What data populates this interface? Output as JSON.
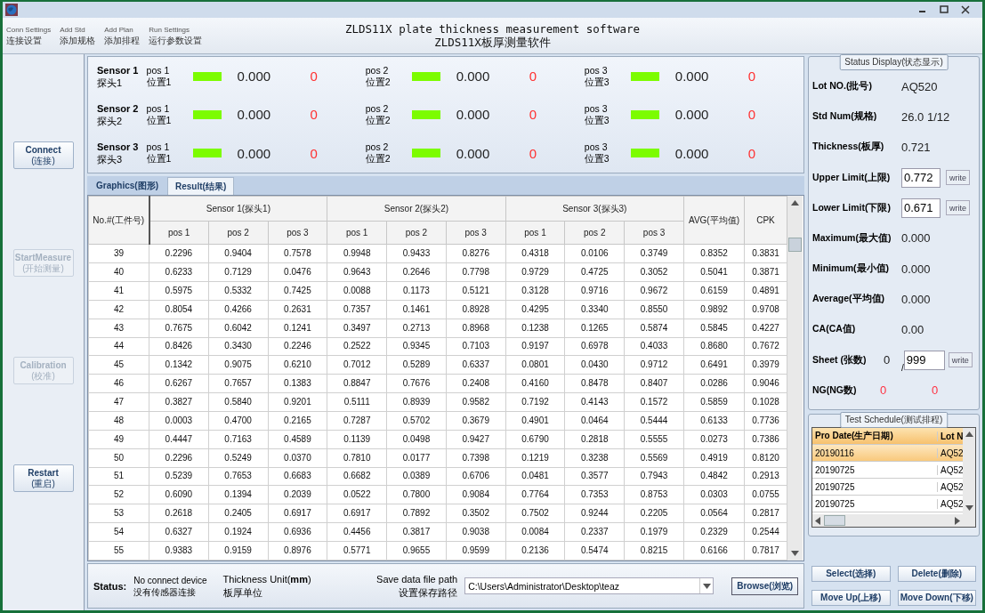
{
  "toolbar": [
    {
      "en": "Conn Settings",
      "zh": "连接设置"
    },
    {
      "en": "Add Std",
      "zh": "添加规格"
    },
    {
      "en": "Add Plan",
      "zh": "添加排程"
    },
    {
      "en": "Run Settings",
      "zh": "运行参数设置"
    }
  ],
  "title": {
    "en": "ZLDS11X plate thickness measurement software",
    "zh": "ZLDS11X板厚测量软件"
  },
  "side_buttons": [
    {
      "en": "Connect",
      "zh": "(连接)",
      "disabled": false
    },
    {
      "en": "StartMeasure",
      "zh": "(开始测量)",
      "disabled": true
    },
    {
      "en": "Calibration",
      "zh": "(校准)",
      "disabled": true
    },
    {
      "en": "Restart",
      "zh": "(重启)",
      "disabled": false
    }
  ],
  "sensors": [
    {
      "name": "Sensor 1",
      "name_zh": "探头1",
      "positions": [
        {
          "label": "pos 1",
          "label_zh": "位置1",
          "value": "0.000",
          "count": "0"
        },
        {
          "label": "pos 2",
          "label_zh": "位置2",
          "value": "0.000",
          "count": "0"
        },
        {
          "label": "pos 3",
          "label_zh": "位置3",
          "value": "0.000",
          "count": "0"
        }
      ]
    },
    {
      "name": "Sensor 2",
      "name_zh": "探头2",
      "positions": [
        {
          "label": "pos 1",
          "label_zh": "位置1",
          "value": "0.000",
          "count": "0"
        },
        {
          "label": "pos 2",
          "label_zh": "位置2",
          "value": "0.000",
          "count": "0"
        },
        {
          "label": "pos 3",
          "label_zh": "位置3",
          "value": "0.000",
          "count": "0"
        }
      ]
    },
    {
      "name": "Sensor 3",
      "name_zh": "探头3",
      "positions": [
        {
          "label": "pos 1",
          "label_zh": "位置1",
          "value": "0.000",
          "count": "0"
        },
        {
          "label": "pos 2",
          "label_zh": "位置2",
          "value": "0.000",
          "count": "0"
        },
        {
          "label": "pos 3",
          "label_zh": "位置3",
          "value": "0.000",
          "count": "0"
        }
      ]
    }
  ],
  "tabs": [
    {
      "label": "Graphics(图形)",
      "selected": false
    },
    {
      "label": "Result(结果)",
      "selected": true
    }
  ],
  "result_table": {
    "no_header": "No.#(工件号)",
    "group_headers": [
      "Sensor 1(探头1)",
      "Sensor 2(探头2)",
      "Sensor 3(探头3)"
    ],
    "sub_headers": [
      "pos 1",
      "pos 2",
      "pos 3",
      "pos 1",
      "pos 2",
      "pos 3",
      "pos 1",
      "pos 2",
      "pos 3"
    ],
    "avg_header": "AVG(平均值)",
    "cpk_header": "CPK",
    "rows": [
      [
        "39",
        "0.2296",
        "0.9404",
        "0.7578",
        "0.9948",
        "0.9433",
        "0.8276",
        "0.4318",
        "0.0106",
        "0.3749",
        "0.8352",
        "0.3831"
      ],
      [
        "40",
        "0.6233",
        "0.7129",
        "0.0476",
        "0.9643",
        "0.2646",
        "0.7798",
        "0.9729",
        "0.4725",
        "0.3052",
        "0.5041",
        "0.3871"
      ],
      [
        "41",
        "0.5975",
        "0.5332",
        "0.7425",
        "0.0088",
        "0.1173",
        "0.5121",
        "0.3128",
        "0.9716",
        "0.9672",
        "0.6159",
        "0.4891"
      ],
      [
        "42",
        "0.8054",
        "0.4266",
        "0.2631",
        "0.7357",
        "0.1461",
        "0.8928",
        "0.4295",
        "0.3340",
        "0.8550",
        "0.9892",
        "0.9708"
      ],
      [
        "43",
        "0.7675",
        "0.6042",
        "0.1241",
        "0.3497",
        "0.2713",
        "0.8968",
        "0.1238",
        "0.1265",
        "0.5874",
        "0.5845",
        "0.4227"
      ],
      [
        "44",
        "0.8426",
        "0.3430",
        "0.2246",
        "0.2522",
        "0.9345",
        "0.7103",
        "0.9197",
        "0.6978",
        "0.4033",
        "0.8680",
        "0.7672"
      ],
      [
        "45",
        "0.1342",
        "0.9075",
        "0.6210",
        "0.7012",
        "0.5289",
        "0.6337",
        "0.0801",
        "0.0430",
        "0.9712",
        "0.6491",
        "0.3979"
      ],
      [
        "46",
        "0.6267",
        "0.7657",
        "0.1383",
        "0.8847",
        "0.7676",
        "0.2408",
        "0.4160",
        "0.8478",
        "0.8407",
        "0.0286",
        "0.9046"
      ],
      [
        "47",
        "0.3827",
        "0.5840",
        "0.9201",
        "0.5111",
        "0.8939",
        "0.9582",
        "0.7192",
        "0.4143",
        "0.1572",
        "0.5859",
        "0.1028"
      ],
      [
        "48",
        "0.0003",
        "0.4700",
        "0.2165",
        "0.7287",
        "0.5702",
        "0.3679",
        "0.4901",
        "0.0464",
        "0.5444",
        "0.6133",
        "0.7736"
      ],
      [
        "49",
        "0.4447",
        "0.7163",
        "0.4589",
        "0.1139",
        "0.0498",
        "0.9427",
        "0.6790",
        "0.2818",
        "0.5555",
        "0.0273",
        "0.7386"
      ],
      [
        "50",
        "0.2296",
        "0.5249",
        "0.0370",
        "0.7810",
        "0.0177",
        "0.7398",
        "0.1219",
        "0.3238",
        "0.5569",
        "0.4919",
        "0.8120"
      ],
      [
        "51",
        "0.5239",
        "0.7653",
        "0.6683",
        "0.6682",
        "0.0389",
        "0.6706",
        "0.0481",
        "0.3577",
        "0.7943",
        "0.4842",
        "0.2913"
      ],
      [
        "52",
        "0.6090",
        "0.1394",
        "0.2039",
        "0.0522",
        "0.7800",
        "0.9084",
        "0.7764",
        "0.7353",
        "0.8753",
        "0.0303",
        "0.0755"
      ],
      [
        "53",
        "0.2618",
        "0.2405",
        "0.6917",
        "0.6917",
        "0.7892",
        "0.3502",
        "0.7502",
        "0.9244",
        "0.2205",
        "0.0564",
        "0.2817"
      ],
      [
        "54",
        "0.6327",
        "0.1924",
        "0.6936",
        "0.4456",
        "0.3817",
        "0.9038",
        "0.0084",
        "0.2337",
        "0.1979",
        "0.2329",
        "0.2544"
      ],
      [
        "55",
        "0.9383",
        "0.9159",
        "0.8976",
        "0.5771",
        "0.9655",
        "0.9599",
        "0.2136",
        "0.5474",
        "0.8215",
        "0.6166",
        "0.7817"
      ]
    ]
  },
  "status_bar": {
    "label": "Status:",
    "status_en": "No connect device",
    "status_zh": "没有传感器连接",
    "unit_en": "Thickness Unit(**mm**)",
    "unit_zh": "板厚单位",
    "path_en": "Save data file path",
    "path_zh": "设置保存路径",
    "path_value": "C:\\Users\\Administrator\\Desktop\\teaz",
    "browse": "Browse(浏览)"
  },
  "status_display": {
    "title": "Status Display(状态显示)",
    "rows": [
      {
        "kind": "value",
        "label": "Lot NO.(批号)",
        "value": "AQ520"
      },
      {
        "kind": "value",
        "label": "Std Num(规格)",
        "value": "26.0 1/12"
      },
      {
        "kind": "value",
        "label": "Thickness(板厚)",
        "value": "0.721"
      },
      {
        "kind": "input",
        "label": "Upper Limit(上限)",
        "value": "0.772",
        "button": "write"
      },
      {
        "kind": "input",
        "label": "Lower Limit(下限)",
        "value": "0.671",
        "button": "write"
      },
      {
        "kind": "value",
        "label": "Maximum(最大值)",
        "value": "0.000"
      },
      {
        "kind": "value",
        "label": "Minimum(最小值)",
        "value": "0.000"
      },
      {
        "kind": "value",
        "label": "Average(平均值)",
        "value": "0.000"
      },
      {
        "kind": "value",
        "label": "CA(CA值)",
        "value": "0.00"
      },
      {
        "kind": "sheet",
        "label": "Sheet (张数)",
        "value": "0",
        "separator": "/",
        "input": "999",
        "button": "write"
      },
      {
        "kind": "ng",
        "label": "NG(NG数)",
        "value": "0",
        "value2": "0"
      }
    ]
  },
  "test_schedule": {
    "title": "Test Schedule(测试排程)",
    "columns": [
      "Pro Date(生产日期)",
      "Lot N"
    ],
    "rows": [
      {
        "cells": [
          "20190116",
          "AQ52"
        ],
        "selected": true
      },
      {
        "cells": [
          "20190725",
          "AQ52"
        ],
        "selected": false
      },
      {
        "cells": [
          "20190725",
          "AQ52"
        ],
        "selected": false
      },
      {
        "cells": [
          "20190725",
          "AQ52"
        ],
        "selected": false
      }
    ]
  },
  "schedule_buttons": [
    "Select(选择)",
    "Delete(删除)",
    "Move Up(上移)",
    "Move Down(下移)"
  ]
}
